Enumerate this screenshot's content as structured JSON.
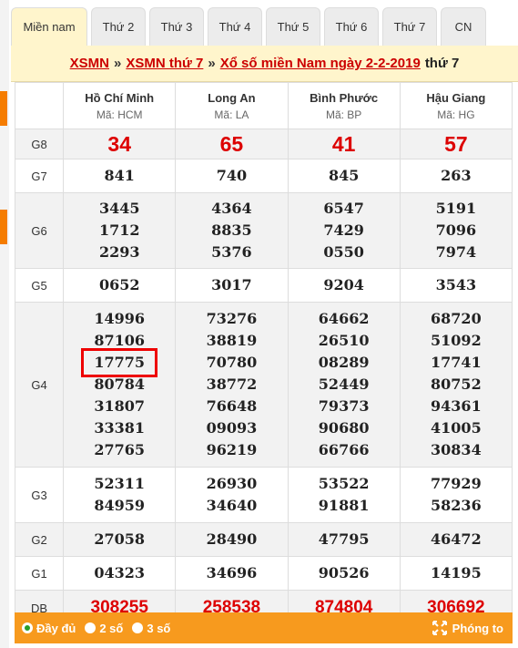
{
  "tabs": [
    "Miền nam",
    "Thứ 2",
    "Thứ 3",
    "Thứ 4",
    "Thứ 5",
    "Thứ 6",
    "Thứ 7",
    "CN"
  ],
  "title": {
    "link1": "XSMN",
    "sep": "»",
    "link2": "XSMN thứ 7",
    "link3": "Xổ số miền Nam ngày 2-2-2019",
    "suffix": "thứ 7"
  },
  "provinces": [
    {
      "name": "Hồ Chí Minh",
      "code": "Mã: HCM"
    },
    {
      "name": "Long An",
      "code": "Mã: LA"
    },
    {
      "name": "Bình Phước",
      "code": "Mã: BP"
    },
    {
      "name": "Hậu Giang",
      "code": "Mã: HG"
    }
  ],
  "prizes": [
    {
      "label": "G8",
      "style": "big",
      "values": [
        [
          "34"
        ],
        [
          "65"
        ],
        [
          "41"
        ],
        [
          "57"
        ]
      ]
    },
    {
      "label": "G7",
      "style": "num",
      "values": [
        [
          "841"
        ],
        [
          "740"
        ],
        [
          "845"
        ],
        [
          "263"
        ]
      ]
    },
    {
      "label": "G6",
      "style": "num",
      "values": [
        [
          "3445",
          "1712",
          "2293"
        ],
        [
          "4364",
          "8835",
          "5376"
        ],
        [
          "6547",
          "7429",
          "0550"
        ],
        [
          "5191",
          "7096",
          "7974"
        ]
      ]
    },
    {
      "label": "G5",
      "style": "num",
      "values": [
        [
          "0652"
        ],
        [
          "3017"
        ],
        [
          "9204"
        ],
        [
          "3543"
        ]
      ]
    },
    {
      "label": "G4",
      "style": "num",
      "values": [
        [
          "14996",
          "87106",
          "17775",
          "80784",
          "31807",
          "33381",
          "27765"
        ],
        [
          "73276",
          "38819",
          "70780",
          "38772",
          "76648",
          "09093",
          "96219"
        ],
        [
          "64662",
          "26510",
          "08289",
          "52449",
          "79373",
          "90680",
          "66766"
        ],
        [
          "68720",
          "51092",
          "17741",
          "80752",
          "94361",
          "41005",
          "30834"
        ]
      ]
    },
    {
      "label": "G3",
      "style": "num",
      "values": [
        [
          "52311",
          "84959"
        ],
        [
          "26930",
          "34640"
        ],
        [
          "53522",
          "91881"
        ],
        [
          "77929",
          "58236"
        ]
      ]
    },
    {
      "label": "G2",
      "style": "num",
      "values": [
        [
          "27058"
        ],
        [
          "28490"
        ],
        [
          "47795"
        ],
        [
          "46472"
        ]
      ]
    },
    {
      "label": "G1",
      "style": "num",
      "values": [
        [
          "04323"
        ],
        [
          "34696"
        ],
        [
          "90526"
        ],
        [
          "14195"
        ]
      ]
    },
    {
      "label": "DB",
      "style": "db",
      "values": [
        [
          "308255"
        ],
        [
          "258538"
        ],
        [
          "874804"
        ],
        [
          "306692"
        ]
      ]
    }
  ],
  "highlighted": {
    "prize": "G4",
    "province_index": 0,
    "value": "17775"
  },
  "footer": {
    "options": [
      {
        "label": "Đầy đủ",
        "selected": true
      },
      {
        "label": "2 số",
        "selected": false
      },
      {
        "label": "3 số",
        "selected": false
      }
    ],
    "zoom_label": "Phóng to"
  },
  "colors": {
    "accent_red": "#d00000",
    "footer_orange": "#f79a1e",
    "title_bg": "#fff5cc",
    "highlight_box": "#e00000"
  }
}
